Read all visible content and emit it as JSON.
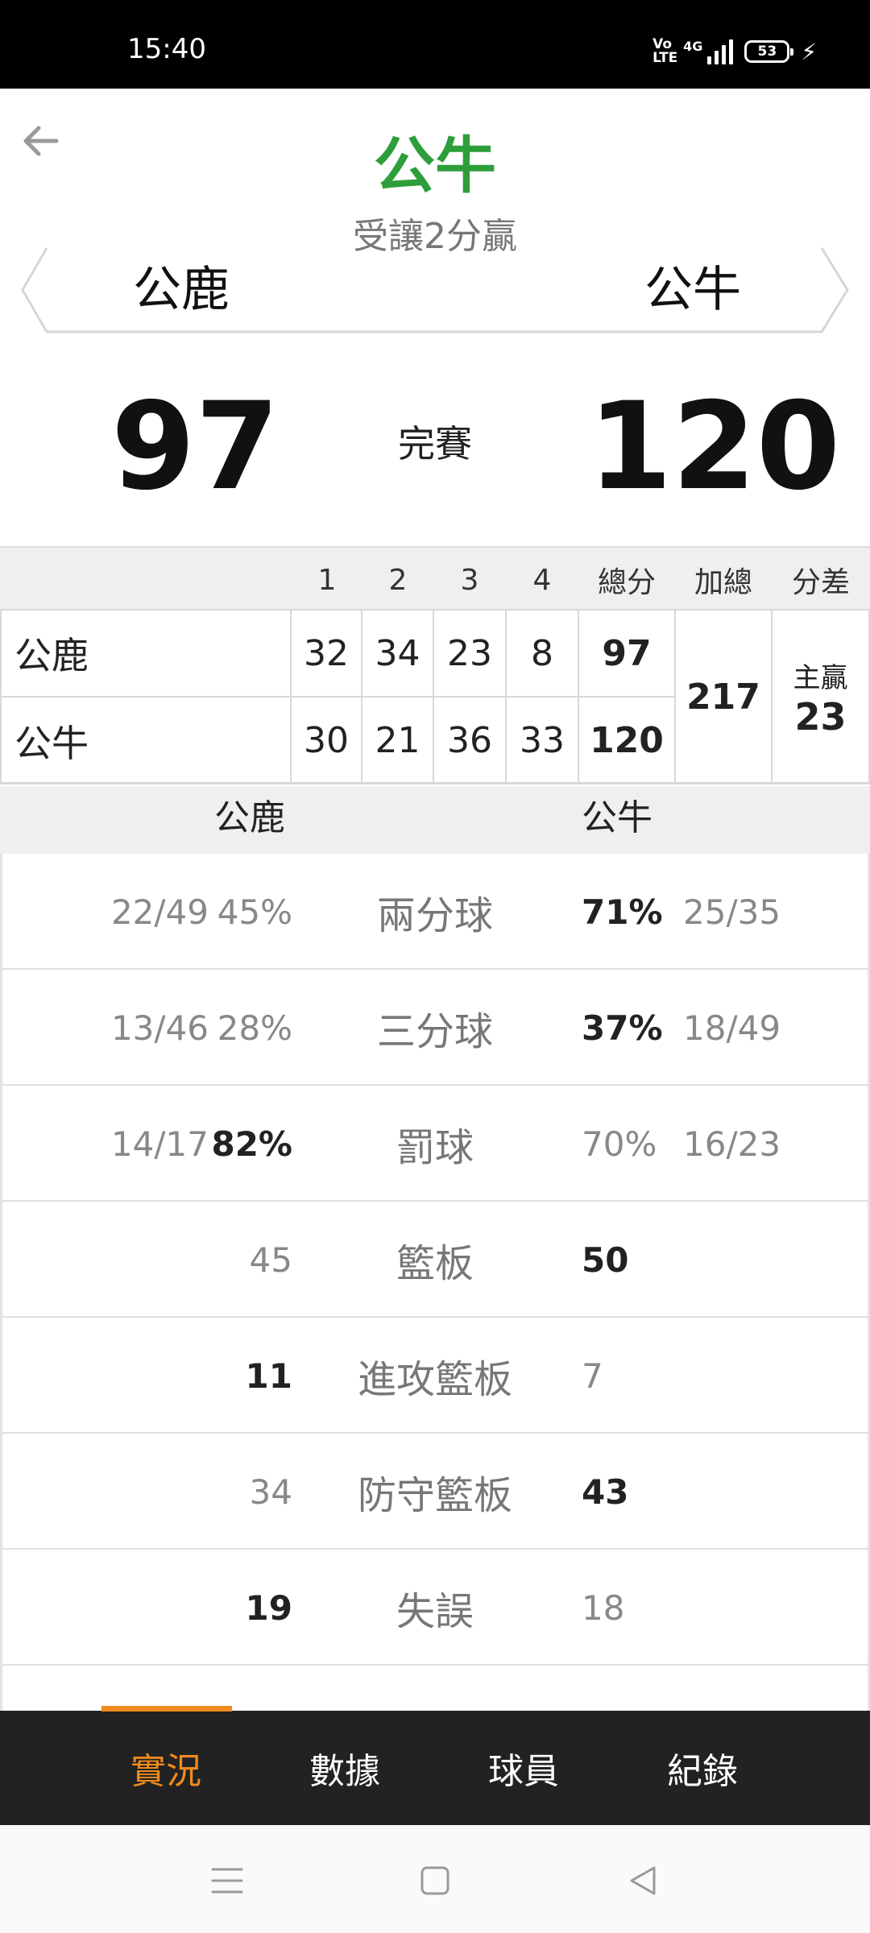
{
  "status_bar": {
    "time": "15:40",
    "volte": "Vo LTE",
    "network": "4G",
    "battery": "53",
    "icons": [
      "volte-icon",
      "signal-icon",
      "battery-icon",
      "charging-icon"
    ]
  },
  "header": {
    "back_icon": "arrow-left-icon",
    "title": "公牛",
    "subtitle": "受讓2分贏",
    "title_color": "#2e9e3a"
  },
  "teams": {
    "away": "公鹿",
    "home": "公牛"
  },
  "score": {
    "away": "97",
    "home": "120",
    "status": "完賽"
  },
  "quarters": {
    "headers": [
      "1",
      "2",
      "3",
      "4",
      "總分",
      "加總",
      "分差"
    ],
    "rows": [
      {
        "team": "公鹿",
        "q": [
          "32",
          "34",
          "23",
          "8"
        ],
        "total": "97"
      },
      {
        "team": "公牛",
        "q": [
          "30",
          "21",
          "36",
          "33"
        ],
        "total": "120"
      }
    ],
    "sum": "217",
    "diff_label": "主贏",
    "diff_value": "23"
  },
  "comparison": {
    "away_team": "公鹿",
    "home_team": "公牛",
    "rows": [
      {
        "label": "兩分球",
        "away_frac": "22/49",
        "away_val": "45%",
        "home_val": "71%",
        "home_frac": "25/35",
        "winner": "home"
      },
      {
        "label": "三分球",
        "away_frac": "13/46",
        "away_val": "28%",
        "home_val": "37%",
        "home_frac": "18/49",
        "winner": "home"
      },
      {
        "label": "罰球",
        "away_frac": "14/17",
        "away_val": "82%",
        "home_val": "70%",
        "home_frac": "16/23",
        "winner": "away"
      },
      {
        "label": "籃板",
        "away_frac": "",
        "away_val": "45",
        "home_val": "50",
        "home_frac": "",
        "winner": "home"
      },
      {
        "label": "進攻籃板",
        "away_frac": "",
        "away_val": "11",
        "home_val": "7",
        "home_frac": "",
        "winner": "away"
      },
      {
        "label": "防守籃板",
        "away_frac": "",
        "away_val": "34",
        "home_val": "43",
        "home_frac": "",
        "winner": "home"
      },
      {
        "label": "失誤",
        "away_frac": "",
        "away_val": "19",
        "home_val": "18",
        "home_frac": "",
        "winner": "away"
      }
    ]
  },
  "tabs": [
    {
      "label": "實況",
      "active": true
    },
    {
      "label": "數據",
      "active": false
    },
    {
      "label": "球員",
      "active": false
    },
    {
      "label": "紀錄",
      "active": false
    }
  ],
  "accent_color": "#f08a1c",
  "nav": [
    "menu-icon",
    "home-icon",
    "back-triangle-icon"
  ]
}
